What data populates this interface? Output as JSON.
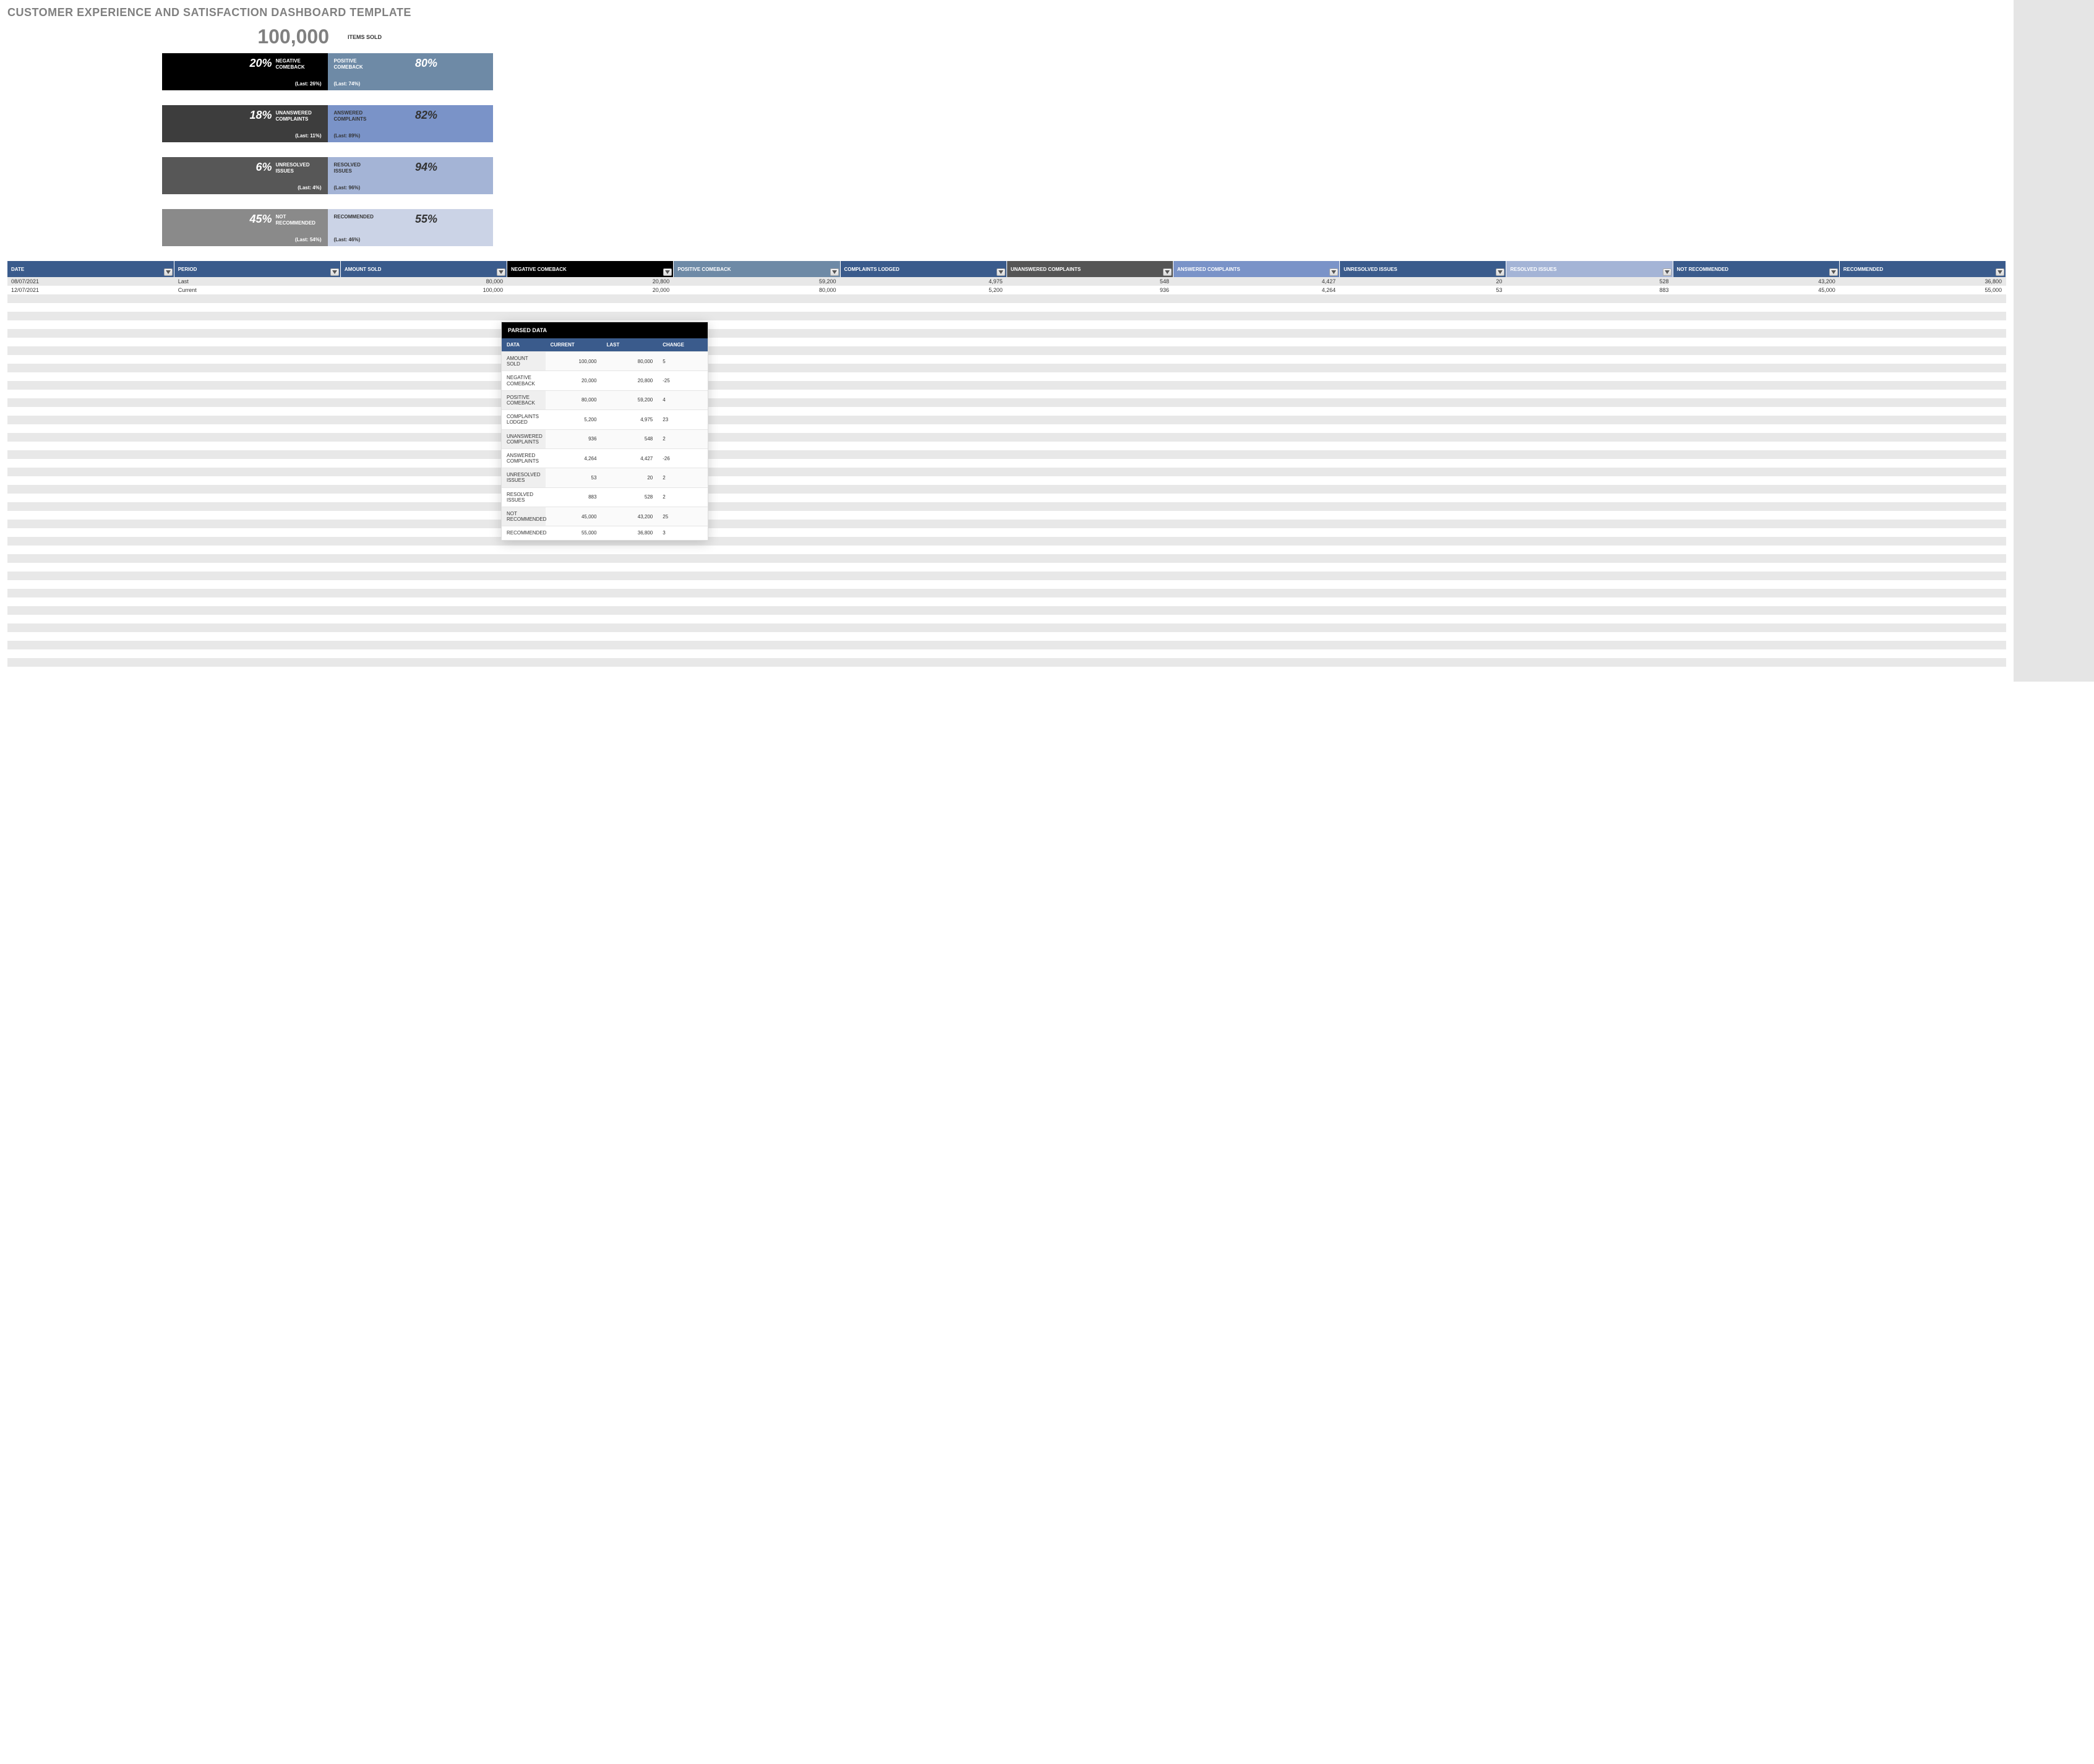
{
  "title": "CUSTOMER EXPERIENCE AND SATISFACTION DASHBOARD TEMPLATE",
  "summary": {
    "items_sold_value": "100,000",
    "items_sold_label": "ITEMS SOLD"
  },
  "bars": [
    {
      "left": {
        "pct": "20%",
        "label": "NEGATIVE COMEBACK",
        "last": "(Last: 26%)",
        "class": "c-black"
      },
      "right": {
        "pct": "80%",
        "label": "POSITIVE COMEBACK",
        "last": "(Last: 74%)",
        "class": "c-slate"
      }
    },
    {
      "left": {
        "pct": "18%",
        "label": "UNANSWERED COMPLAINTS",
        "last": "(Last: 11%)",
        "class": "c-dark1"
      },
      "right": {
        "pct": "82%",
        "label": "ANSWERED COMPLAINTS",
        "last": "(Last: 89%)",
        "class": "c-blue1"
      }
    },
    {
      "left": {
        "pct": "6%",
        "label": "UNRESOLVED ISSUES",
        "last": "(Last: 4%)",
        "class": "c-dark2"
      },
      "right": {
        "pct": "94%",
        "label": "RESOLVED ISSUES",
        "last": "(Last: 96%)",
        "class": "c-blue2"
      }
    },
    {
      "left": {
        "pct": "45%",
        "label": "NOT RECOMMENDED",
        "last": "(Last: 54%)",
        "class": "c-dark3"
      },
      "right": {
        "pct": "55%",
        "label": "RECOMMENDED",
        "last": "(Last: 46%)",
        "class": "c-blue3"
      }
    }
  ],
  "table": {
    "headers": [
      {
        "label": "DATE",
        "class": "h-blue"
      },
      {
        "label": "PERIOD",
        "class": "h-blue"
      },
      {
        "label": "AMOUNT SOLD",
        "class": "h-blue"
      },
      {
        "label": "NEGATIVE COMEBACK",
        "class": "h-black"
      },
      {
        "label": "POSITIVE COMEBACK",
        "class": "h-slate"
      },
      {
        "label": "COMPLAINTS LODGED",
        "class": "h-blue"
      },
      {
        "label": "UNANSWERED COMPLAINTS",
        "class": "h-grey"
      },
      {
        "label": "ANSWERED COMPLAINTS",
        "class": "h-lblue"
      },
      {
        "label": "UNRESOLVED ISSUES",
        "class": "h-blue"
      },
      {
        "label": "RESOLVED ISSUES",
        "class": "h-lblue2"
      },
      {
        "label": "NOT RECOMMENDED",
        "class": "h-blue"
      },
      {
        "label": "RECOMMENDED",
        "class": "h-blue"
      }
    ],
    "rows": [
      {
        "date": "08/07/2021",
        "period": "Last",
        "cells": [
          "80,000",
          "20,800",
          "59,200",
          "4,975",
          "548",
          "4,427",
          "20",
          "528",
          "43,200",
          "36,800"
        ]
      },
      {
        "date": "12/07/2021",
        "period": "Current",
        "cells": [
          "100,000",
          "20,000",
          "80,000",
          "5,200",
          "936",
          "4,264",
          "53",
          "883",
          "45,000",
          "55,000"
        ]
      }
    ],
    "empty_rows": 44
  },
  "parsed": {
    "title": "PARSED DATA",
    "headers": [
      "DATA",
      "CURRENT",
      "LAST",
      "CHANGE"
    ],
    "rows": [
      {
        "label": "AMOUNT SOLD",
        "current": "100,000",
        "last": "80,000",
        "change": "5"
      },
      {
        "label": "NEGATIVE COMEBACK",
        "current": "20,000",
        "last": "20,800",
        "change": "-25"
      },
      {
        "label": "POSITIVE COMEBACK",
        "current": "80,000",
        "last": "59,200",
        "change": "4"
      },
      {
        "label": "COMPLAINTS LODGED",
        "current": "5,200",
        "last": "4,975",
        "change": "23"
      },
      {
        "label": "UNANSWERED COMPLAINTS",
        "current": "936",
        "last": "548",
        "change": "2"
      },
      {
        "label": "ANSWERED COMPLAINTS",
        "current": "4,264",
        "last": "4,427",
        "change": "-26"
      },
      {
        "label": "UNRESOLVED ISSUES",
        "current": "53",
        "last": "20",
        "change": "2"
      },
      {
        "label": "RESOLVED ISSUES",
        "current": "883",
        "last": "528",
        "change": "2"
      },
      {
        "label": "NOT RECOMMENDED",
        "current": "45,000",
        "last": "43,200",
        "change": "25"
      },
      {
        "label": "RECOMMENDED",
        "current": "55,000",
        "last": "36,800",
        "change": "3"
      }
    ]
  },
  "chart_data": [
    {
      "type": "bar",
      "title": "Negative vs Positive Comeback",
      "categories": [
        "Negative Comeback",
        "Positive Comeback"
      ],
      "values_pct": [
        20,
        80
      ],
      "last_pct": [
        26,
        74
      ]
    },
    {
      "type": "bar",
      "title": "Unanswered vs Answered Complaints",
      "categories": [
        "Unanswered Complaints",
        "Answered Complaints"
      ],
      "values_pct": [
        18,
        82
      ],
      "last_pct": [
        11,
        89
      ]
    },
    {
      "type": "bar",
      "title": "Unresolved vs Resolved Issues",
      "categories": [
        "Unresolved Issues",
        "Resolved Issues"
      ],
      "values_pct": [
        6,
        94
      ],
      "last_pct": [
        4,
        96
      ]
    },
    {
      "type": "bar",
      "title": "Not Recommended vs Recommended",
      "categories": [
        "Not Recommended",
        "Recommended"
      ],
      "values_pct": [
        45,
        55
      ],
      "last_pct": [
        54,
        46
      ]
    }
  ]
}
